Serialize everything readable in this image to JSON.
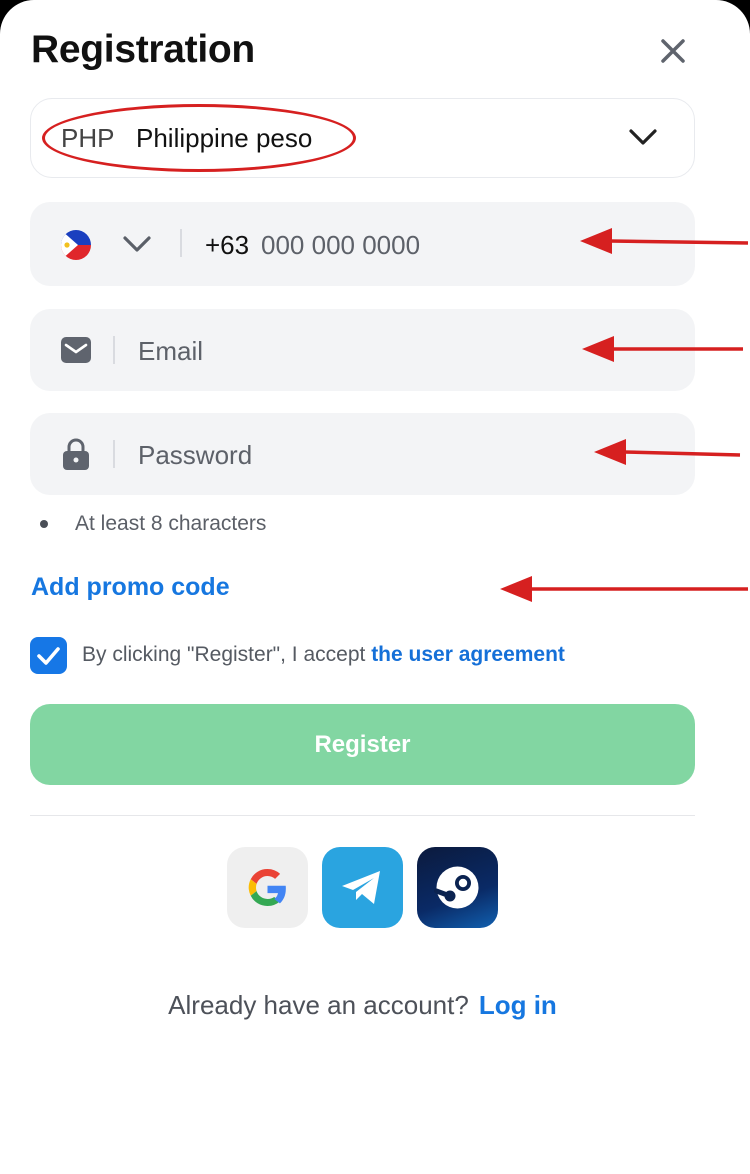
{
  "header": {
    "title": "Registration",
    "close_icon": "close-icon"
  },
  "currency": {
    "code": "PHP",
    "name": "Philippine peso",
    "dropdown_icon": "chevron-down-icon"
  },
  "phone": {
    "country_flag": "philippines-flag-icon",
    "prefix": "+63",
    "placeholder": "000 000 0000"
  },
  "email": {
    "placeholder": "Email",
    "icon": "envelope-icon"
  },
  "password": {
    "placeholder": "Password",
    "icon": "lock-icon",
    "hint": "At least 8 characters"
  },
  "promo": {
    "label": "Add promo code"
  },
  "agreement": {
    "checked": true,
    "text": "By clicking \"Register\", I accept ",
    "link": "the user agreement"
  },
  "register": {
    "label": "Register"
  },
  "social": [
    "google-icon",
    "telegram-icon",
    "steam-icon"
  ],
  "footer": {
    "question": "Already have an account?",
    "login_label": "Log in"
  },
  "colors": {
    "accent": "#1677e0",
    "register_bg": "#82d6a2",
    "field_bg": "#f3f4f6",
    "annotation_red": "#d62020"
  }
}
